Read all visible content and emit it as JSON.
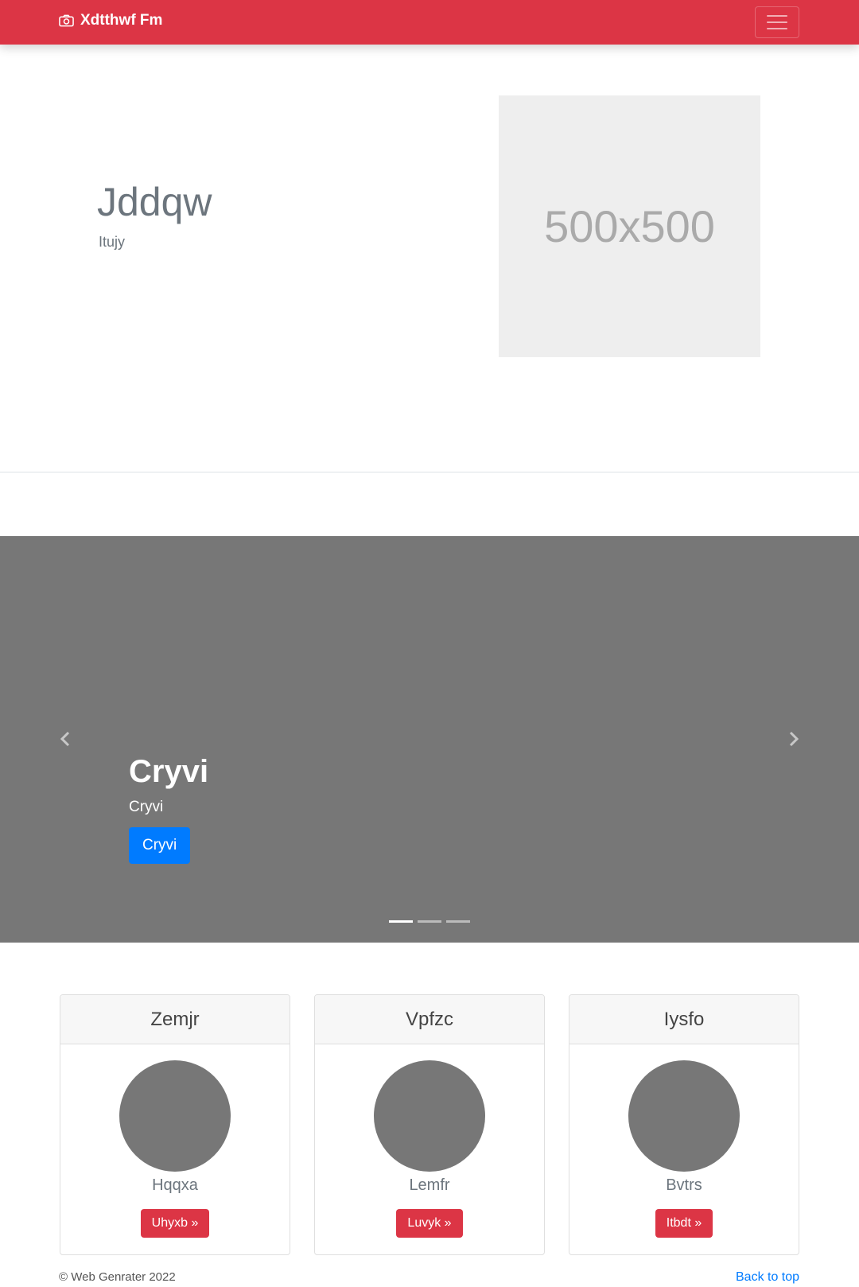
{
  "navbar": {
    "brand": "Xdtthwf Fm",
    "brand_icon": "camera-icon",
    "toggler_icon": "hamburger-icon",
    "color": "#dc3545"
  },
  "hero": {
    "title": "Jddqw",
    "subtitle": "Itujy",
    "image_placeholder": "500x500"
  },
  "carousel": {
    "title": "Cryvi",
    "subtitle": "Cryvi",
    "button": "Cryvi",
    "prev_icon": "chevron-left-icon",
    "next_icon": "chevron-right-icon",
    "slides_count": 3,
    "active_slide": 1
  },
  "cards": [
    {
      "title": "Zemjr",
      "name": "Hqqxa",
      "button": "Uhyxb »"
    },
    {
      "title": "Vpfzc",
      "name": "Lemfr",
      "button": "Luvyk »"
    },
    {
      "title": "Iysfo",
      "name": "Bvtrs",
      "button": "Itbdt »"
    }
  ],
  "footer": {
    "copyright": "© Web Genrater 2022",
    "back_to_top": "Back to top"
  },
  "colors": {
    "primary": "#007bff",
    "danger": "#dc3545",
    "placeholder_bg": "#777777"
  }
}
